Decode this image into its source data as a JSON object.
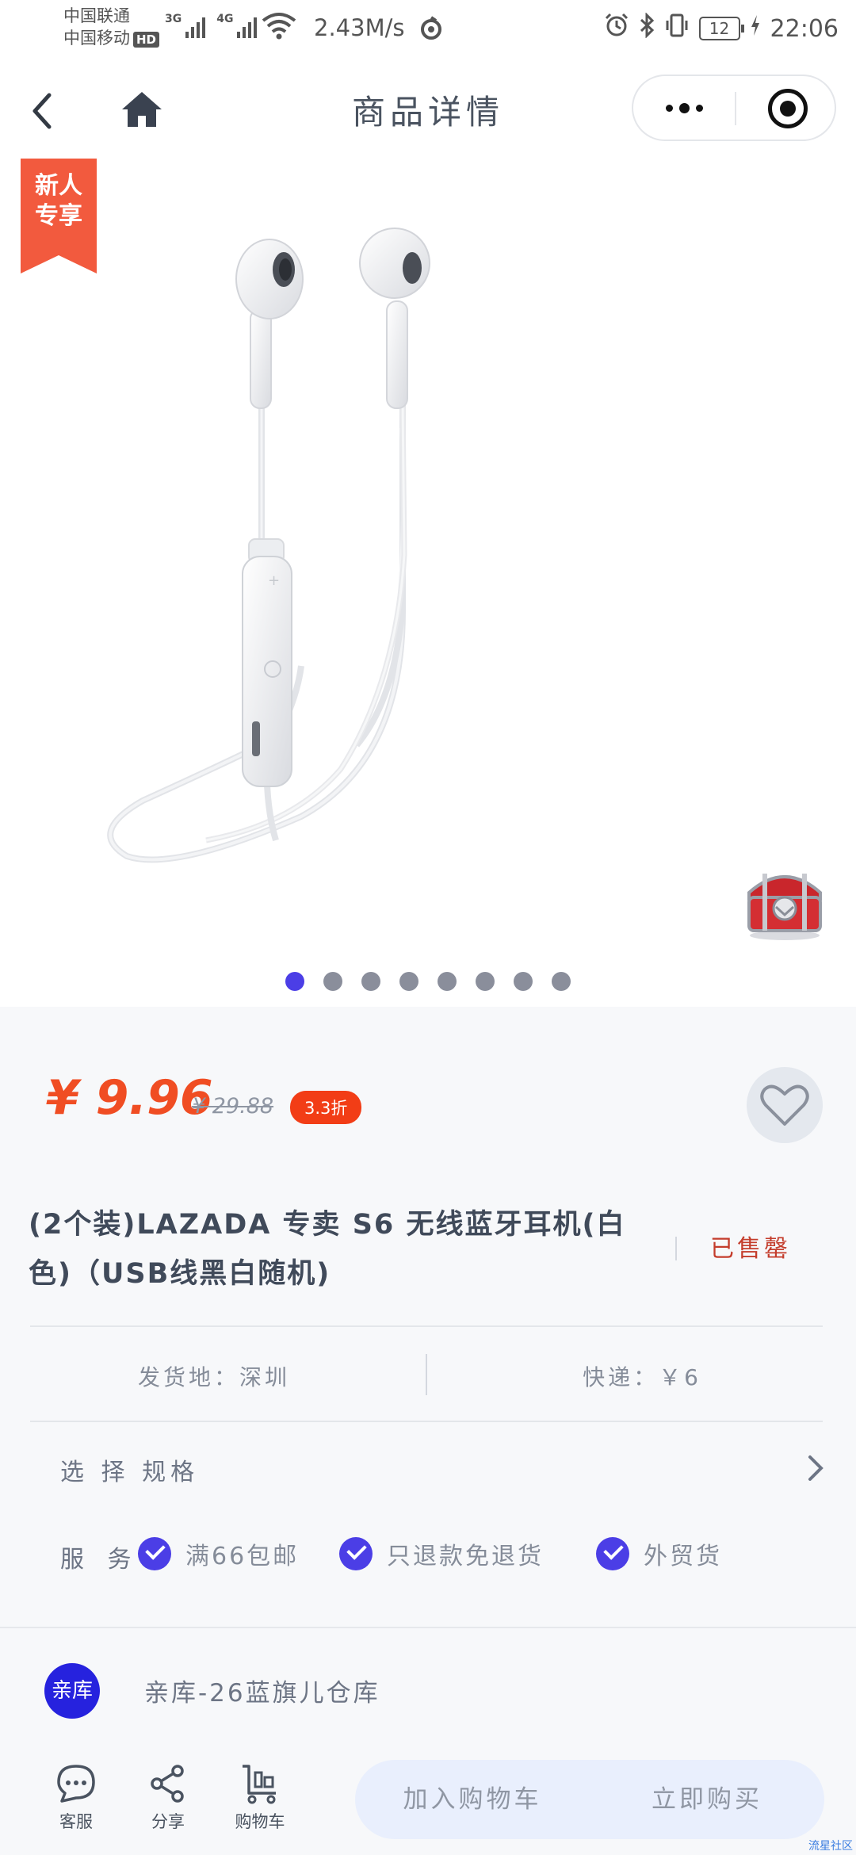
{
  "status_bar": {
    "carrier_1": "中国联通",
    "carrier_2": "中国移动",
    "hd": "HD",
    "net_1": "3G",
    "net_2": "4G",
    "speed": "2.43M/s",
    "battery": "12",
    "time": "22:06"
  },
  "nav": {
    "title": "商品详情"
  },
  "gallery": {
    "badge_line_1": "新人",
    "badge_line_2": "专享",
    "slide_count": 8,
    "active_slide": 1
  },
  "price": {
    "current": "¥ 9.96",
    "original": "¥ 29.88",
    "discount": "3.3折"
  },
  "product": {
    "title": "(2个装)LAZADA 专卖 S6 无线蓝牙耳机(白色)（USB线黑白随机)",
    "sold_status": "已售罄"
  },
  "shipping": {
    "from": "发货地：深圳",
    "fee": "快递：￥6"
  },
  "spec": {
    "label": "选 择 规格"
  },
  "services": {
    "label": "服 务",
    "items": [
      "满66包邮",
      "只退款免退货",
      "外贸货"
    ]
  },
  "shop": {
    "logo_text": "亲库",
    "name": "亲库-26蓝旗儿仓库"
  },
  "bottom_bar": {
    "service_label": "客服",
    "share_label": "分享",
    "cart_label": "购物车",
    "add_to_cart": "加入购物车",
    "buy_now": "立即购买"
  },
  "watermark": "流星社区",
  "colors": {
    "accent": "#4b3ee6",
    "price": "#f04d23",
    "discount_bg": "#f23d16",
    "shop_logo": "#2622de",
    "action_bg": "#e9effd"
  },
  "icons": [
    "back-icon",
    "home-icon",
    "more-icon",
    "close-target-icon",
    "heart-icon",
    "chat-icon",
    "share-icon",
    "cart-icon",
    "chevron-right-icon",
    "check-icon"
  ]
}
